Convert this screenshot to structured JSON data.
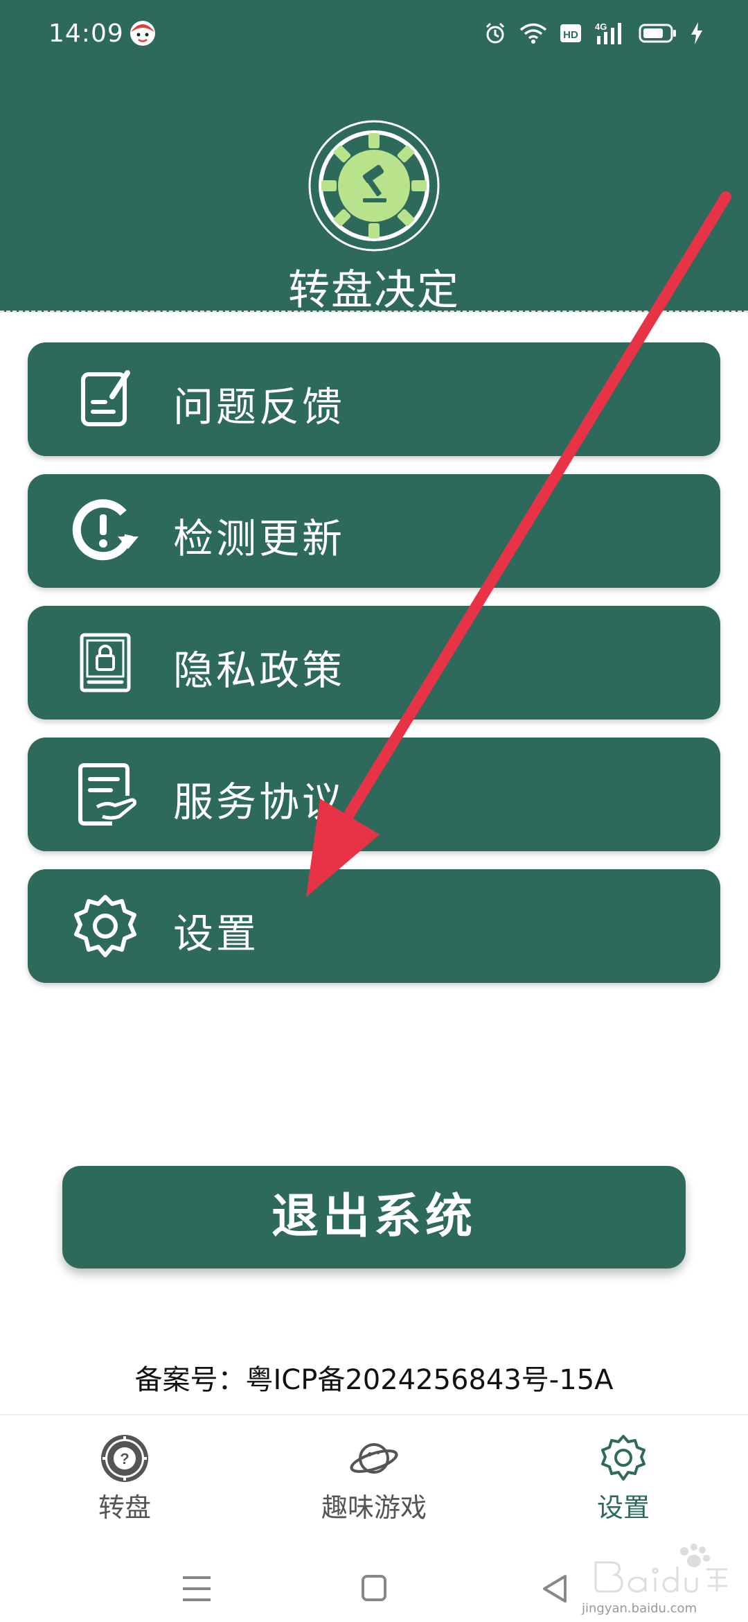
{
  "status_bar": {
    "time": "14:09",
    "icons": [
      "avatar-icon",
      "alarm-icon",
      "wifi-icon",
      "hd-icon",
      "signal-4g-icon",
      "battery-icon",
      "charging-icon"
    ]
  },
  "header": {
    "title": "转盘决定"
  },
  "menu": [
    {
      "label": "问题反馈",
      "icon": "feedback-icon"
    },
    {
      "label": "检测更新",
      "icon": "update-icon"
    },
    {
      "label": "隐私政策",
      "icon": "privacy-icon"
    },
    {
      "label": "服务协议",
      "icon": "agreement-icon"
    },
    {
      "label": "设置",
      "icon": "settings-icon"
    }
  ],
  "logout_label": "退出系统",
  "icp_text": "备案号：粤ICP备2024256843号-15A",
  "bottom_nav": [
    {
      "label": "转盘",
      "icon": "wheel-icon",
      "active": false
    },
    {
      "label": "趣味游戏",
      "icon": "planet-icon",
      "active": false
    },
    {
      "label": "设置",
      "icon": "gear-icon",
      "active": true
    }
  ],
  "colors": {
    "primary": "#2e6a5c",
    "logo_wheel": "#b8e28c",
    "arrow": "#e83347"
  },
  "watermark": {
    "text": "jingyan.baidu.com"
  }
}
